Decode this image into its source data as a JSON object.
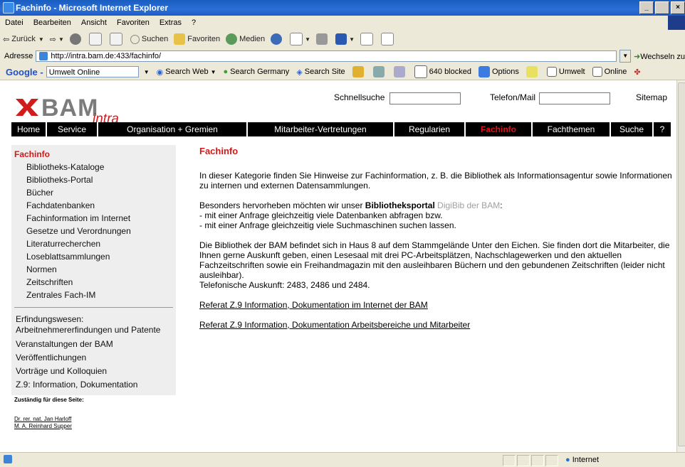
{
  "window": {
    "title": "Fachinfo - Microsoft Internet Explorer",
    "controls": [
      "_",
      " ",
      "×"
    ]
  },
  "menu": [
    "Datei",
    "Bearbeiten",
    "Ansicht",
    "Favoriten",
    "Extras",
    "?"
  ],
  "toolbar": {
    "back": "Zurück",
    "search": "Suchen",
    "favorites": "Favoriten",
    "media": "Medien"
  },
  "address": {
    "label": "Adresse",
    "url": "http://intra.bam.de:433/fachinfo/",
    "go": "Wechseln zu"
  },
  "googlebar": {
    "logo": "Google -",
    "field": "Umwelt Online",
    "search_web": "Search Web",
    "search_germany": "Search Germany",
    "search_site": "Search Site",
    "blocked": "640 blocked",
    "options": "Options",
    "umwelt": "Umwelt",
    "online": "Online"
  },
  "header": {
    "logo_main": "BAM",
    "logo_sub": "intra",
    "quicksearch_label": "Schnellsuche",
    "phone_label": "Telefon/Mail",
    "sitemap": "Sitemap"
  },
  "nav": [
    {
      "label": "Home",
      "active": false
    },
    {
      "label": "Service",
      "active": false
    },
    {
      "label": "Organisation + Gremien",
      "active": false
    },
    {
      "label": "Mitarbeiter-Vertretungen",
      "active": false
    },
    {
      "label": "Regularien",
      "active": false
    },
    {
      "label": "Fachinfo",
      "active": true
    },
    {
      "label": "Fachthemen",
      "active": false
    },
    {
      "label": "Suche",
      "active": false
    },
    {
      "label": "?",
      "active": false
    }
  ],
  "sidebar": {
    "title": "Fachinfo",
    "subitems": [
      "Bibliotheks-Kataloge",
      "Bibliotheks-Portal",
      "Bücher",
      "Fachdatenbanken",
      "Fachinformation im Internet",
      "Gesetze und Verordnungen",
      "Literaturrecherchen",
      "Loseblattsammlungen",
      "Normen",
      "Zeitschriften",
      "Zentrales Fach-IM"
    ],
    "items": [
      "Erfindungswesen: Arbeitnehmererfindungen und Patente",
      "Veranstaltungen der BAM",
      "Veröffentlichungen",
      "Vorträge und Kolloquien",
      "Z.9: Information, Dokumentation"
    ]
  },
  "responsible": {
    "heading": "Zuständig für diese Seite:",
    "persons": [
      "Dr. rer. nat. Jan Harloff",
      "M. A. Reinhard Supper"
    ]
  },
  "content": {
    "title": "Fachinfo",
    "intro": "In dieser Kategorie finden Sie Hinweise zur Fachinformation, z. B. die Bibliothek als Informationsagentur sowie Informationen zu internen und externen Datensammlungen.",
    "highlight_pre": "Besonders hervorheben möchten wir unser ",
    "highlight_bold": "Bibliotheksportal",
    "highlight_link": "DigiBib der BAM",
    "highlight_post": ":",
    "bullet1": "- mit einer Anfrage gleichzeitig viele Datenbanken abfragen bzw.",
    "bullet2": "- mit einer Anfrage gleichzeitig viele Suchmaschinen suchen lassen.",
    "library": "Die Bibliothek der BAM befindet sich in Haus 8 auf dem Stammgelände Unter den Eichen. Sie finden dort die Mitarbeiter, die Ihnen gerne Auskunft geben, einen Lesesaal mit drei PC-Arbeitsplätzen, Nachschlagewerken und den aktuellen Fachzeitschriften sowie ein Freihandmagazin mit den ausleihbaren Büchern und den gebundenen Zeitschriften (leider nicht ausleihbar).",
    "phone": "Telefonische Auskunft: 2483, 2486 und 2484.",
    "link1": "Referat Z.9 Information, Dokumentation im Internet der BAM",
    "link2": "Referat Z.9 Information, Dokumentation Arbeitsbereiche und Mitarbeiter"
  },
  "status": {
    "zone": "Internet"
  },
  "colors": {
    "accent": "#d01a1a",
    "nav_bg": "#000000",
    "sidebar_bg": "#eeeeee",
    "titlebar": "#1f5cc4"
  }
}
